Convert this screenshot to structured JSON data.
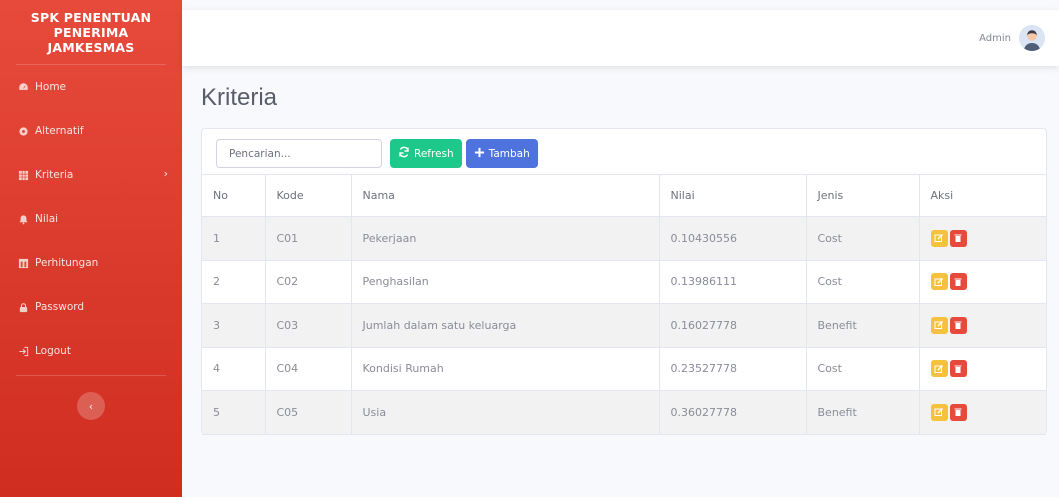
{
  "sidebar": {
    "brand": "SPK PENENTUAN PENERIMA JAMKESMAS",
    "items": [
      {
        "label": "Home",
        "icon": "dashboard-icon"
      },
      {
        "label": "Alternatif",
        "icon": "gear-icon"
      },
      {
        "label": "Kriteria",
        "icon": "table-icon",
        "has_chevron": true,
        "active": true
      },
      {
        "label": "Nilai",
        "icon": "bell-icon"
      },
      {
        "label": "Perhitungan",
        "icon": "calculator-icon"
      },
      {
        "label": "Password",
        "icon": "lock-icon"
      },
      {
        "label": "Logout",
        "icon": "logout-icon"
      }
    ],
    "toggle_icon": "chevron-left-icon"
  },
  "topbar": {
    "user_name": "Admin"
  },
  "main": {
    "title": "Kriteria",
    "search_placeholder": "Pencarian...",
    "refresh_label": "Refresh",
    "add_label": "Tambah",
    "table": {
      "headers": [
        "No",
        "Kode",
        "Nama",
        "Nilai",
        "Jenis",
        "Aksi"
      ],
      "rows": [
        [
          "1",
          "C01",
          "Pekerjaan",
          "0.10430556",
          "Cost"
        ],
        [
          "2",
          "C02",
          "Penghasilan",
          "0.13986111",
          "Cost"
        ],
        [
          "3",
          "C03",
          "Jumlah dalam satu keluarga",
          "0.16027778",
          "Benefit"
        ],
        [
          "4",
          "C04",
          "Kondisi Rumah",
          "0.23527778",
          "Cost"
        ],
        [
          "5",
          "C05",
          "Usia",
          "0.36027778",
          "Benefit"
        ]
      ]
    }
  },
  "colors": {
    "sidebar": "#e74a3b",
    "success": "#1cc88a",
    "primary": "#4e73df",
    "warning": "#f6c23e",
    "danger": "#e74a3b"
  }
}
